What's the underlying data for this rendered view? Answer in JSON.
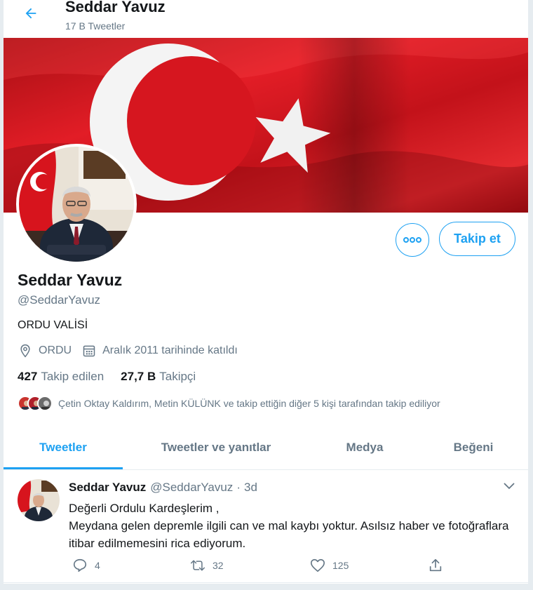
{
  "header": {
    "back_icon": "arrow-left-icon",
    "title": "Seddar Yavuz",
    "tweet_count": "17 B Tweetler"
  },
  "profile": {
    "name": "Seddar Yavuz",
    "handle": "@SeddarYavuz",
    "bio": "ORDU VALİSİ",
    "location": "ORDU",
    "joined": "Aralık 2011 tarihinde katıldı",
    "following_count": "427",
    "following_label": "Takip edilen",
    "followers_count": "27,7 B",
    "followers_label": "Takipçi",
    "followed_by_text": "Çetin Oktay Kaldırım, Metin KÜLÜNK ve takip ettiğin diğer 5 kişi tarafından takip ediliyor",
    "follow_button": "Takip et",
    "more_icon": "more-options-icon"
  },
  "tabs": [
    {
      "label": "Tweetler",
      "active": true
    },
    {
      "label": "Tweetler ve yanıtlar",
      "active": false
    },
    {
      "label": "Medya",
      "active": false
    },
    {
      "label": "Beğeni",
      "active": false
    }
  ],
  "tweet": {
    "name": "Seddar Yavuz",
    "handle": "@SeddarYavuz",
    "separator": "·",
    "time": "3d",
    "line1": "Değerli Ordulu Kardeşlerim ,",
    "line2": "Meydana gelen depremle ilgili can ve mal kaybı yoktur. Asılsız haber ve fotoğraflara itibar edilmemesini rica ediyorum.",
    "replies": "4",
    "retweets": "32",
    "likes": "125"
  },
  "colors": {
    "accent": "#1da1f2",
    "secondary_text": "#657786",
    "flag_red": "#d8141e"
  }
}
